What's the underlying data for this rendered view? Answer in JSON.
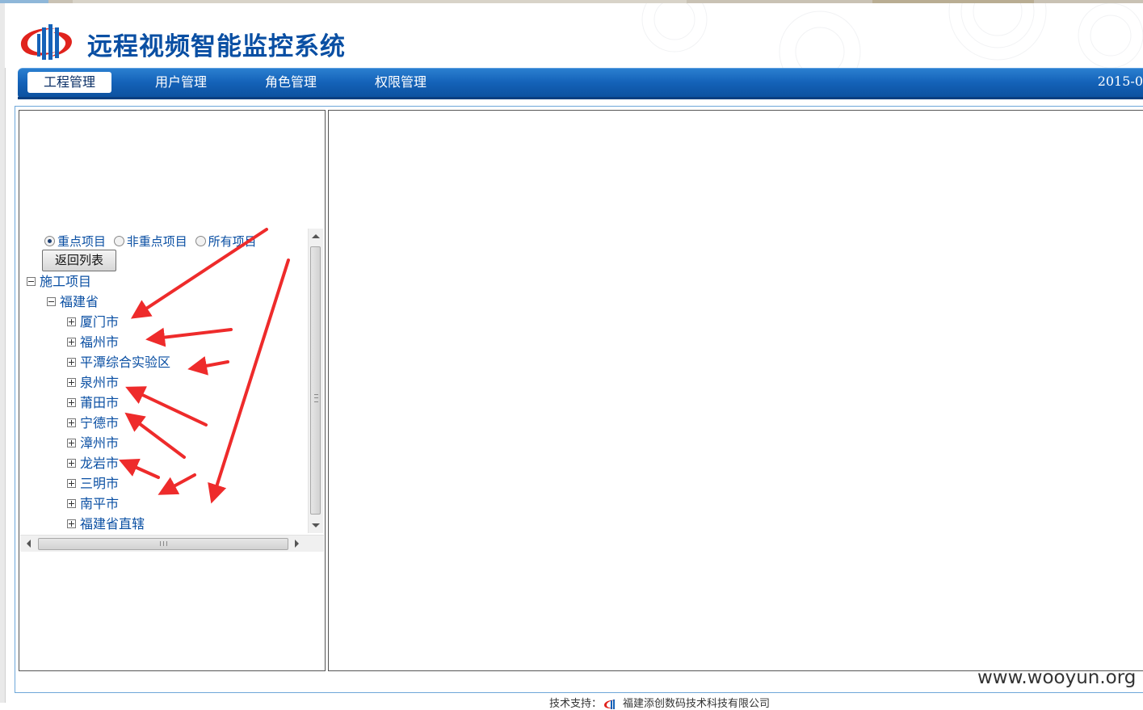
{
  "app": {
    "title": "远程视频智能监控系统"
  },
  "nav": {
    "tabs": [
      {
        "label": "工程管理",
        "active": true
      },
      {
        "label": "用户管理",
        "active": false
      },
      {
        "label": "角色管理",
        "active": false
      },
      {
        "label": "权限管理",
        "active": false
      }
    ],
    "date": "2015-0"
  },
  "filter": {
    "options": [
      {
        "label": "重点项目",
        "checked": true
      },
      {
        "label": "非重点项目",
        "checked": false
      },
      {
        "label": "所有项目",
        "checked": false
      }
    ],
    "back_button": "返回列表"
  },
  "tree": {
    "root": {
      "label": "施工项目",
      "expanded": true
    },
    "province": {
      "label": "福建省",
      "expanded": true
    },
    "cities": [
      {
        "label": "厦门市"
      },
      {
        "label": "福州市"
      },
      {
        "label": "平潭综合实验区"
      },
      {
        "label": "泉州市"
      },
      {
        "label": "莆田市"
      },
      {
        "label": "宁德市"
      },
      {
        "label": "漳州市"
      },
      {
        "label": "龙岩市"
      },
      {
        "label": "三明市"
      },
      {
        "label": "南平市"
      },
      {
        "label": "福建省直辖"
      }
    ]
  },
  "watermark": "www.wooyun.org",
  "footer": {
    "support_label": "技术支持：",
    "company": "福建添创数码技术科技有限公司"
  },
  "colors": {
    "brand_blue": "#0a4fa3",
    "nav_blue": "#1462b8",
    "annotation_red": "#ee2b2b"
  },
  "icons": {
    "logo": "company-logo",
    "expand": "plus-box-icon",
    "collapse": "minus-box-icon"
  }
}
